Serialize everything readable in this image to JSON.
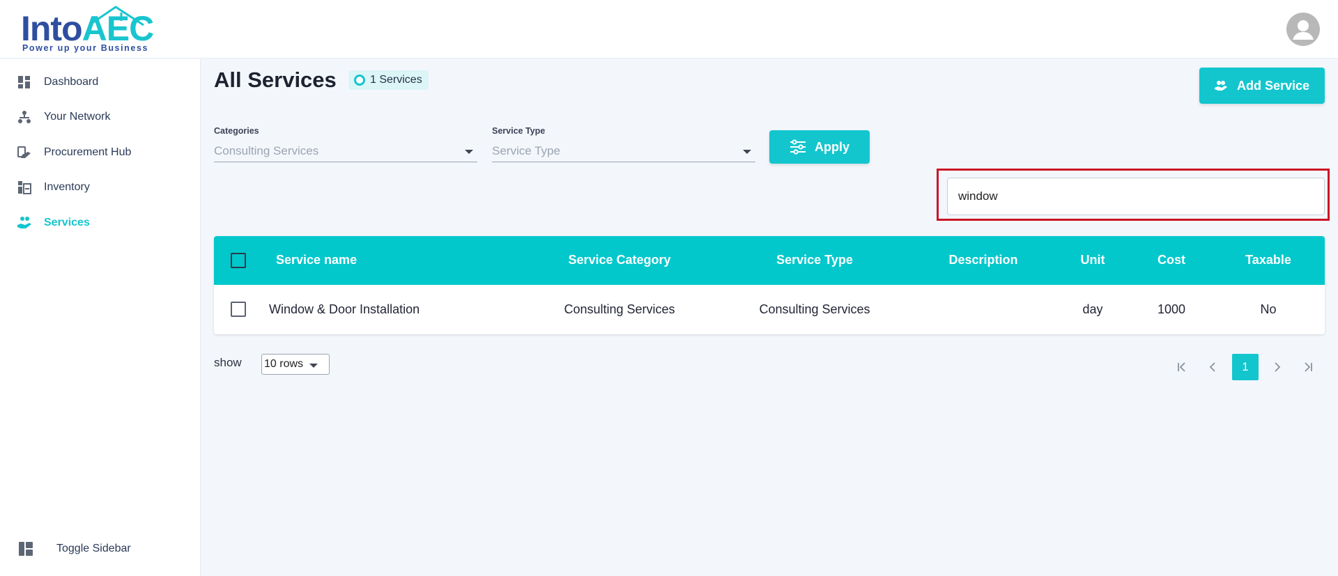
{
  "header": {
    "logo": {
      "word": "Into",
      "accent": "AEC",
      "tagline": "Power up your Business"
    },
    "avatar_icon": "user-avatar-icon"
  },
  "sidebar": {
    "items": [
      {
        "label": "Dashboard",
        "icon": "dashboard-icon",
        "active": false
      },
      {
        "label": "Your Network",
        "icon": "network-icon",
        "active": false
      },
      {
        "label": "Procurement Hub",
        "icon": "procurement-icon",
        "active": false
      },
      {
        "label": "Inventory",
        "icon": "inventory-icon",
        "active": false
      },
      {
        "label": "Services",
        "icon": "services-icon",
        "active": true
      }
    ],
    "toggle_label": "Toggle Sidebar"
  },
  "main": {
    "title": "All Services",
    "count_badge": "1 Services",
    "add_button": "Add Service",
    "filters": {
      "categories_label": "Categories",
      "categories_value": "Consulting Services",
      "service_type_label": "Service Type",
      "service_type_placeholder": "Service Type",
      "apply_button": "Apply"
    },
    "search": {
      "value": "window"
    },
    "table": {
      "columns": [
        "Service name",
        "Service Category",
        "Service Type",
        "Description",
        "Unit",
        "Cost",
        "Taxable"
      ],
      "rows": [
        {
          "name": "Window & Door Installation",
          "category": "Consulting Services",
          "type": "Consulting Services",
          "description": "",
          "unit": "day",
          "cost": "1000",
          "taxable": "No"
        }
      ]
    },
    "footer": {
      "show_label": "show",
      "rows_option": "10 rows",
      "current_page": "1"
    }
  },
  "colors": {
    "accent": "#13c6ce",
    "table_header": "#02c8cc",
    "highlight": "#cc1426",
    "brand_blue": "#2e4fa0"
  }
}
